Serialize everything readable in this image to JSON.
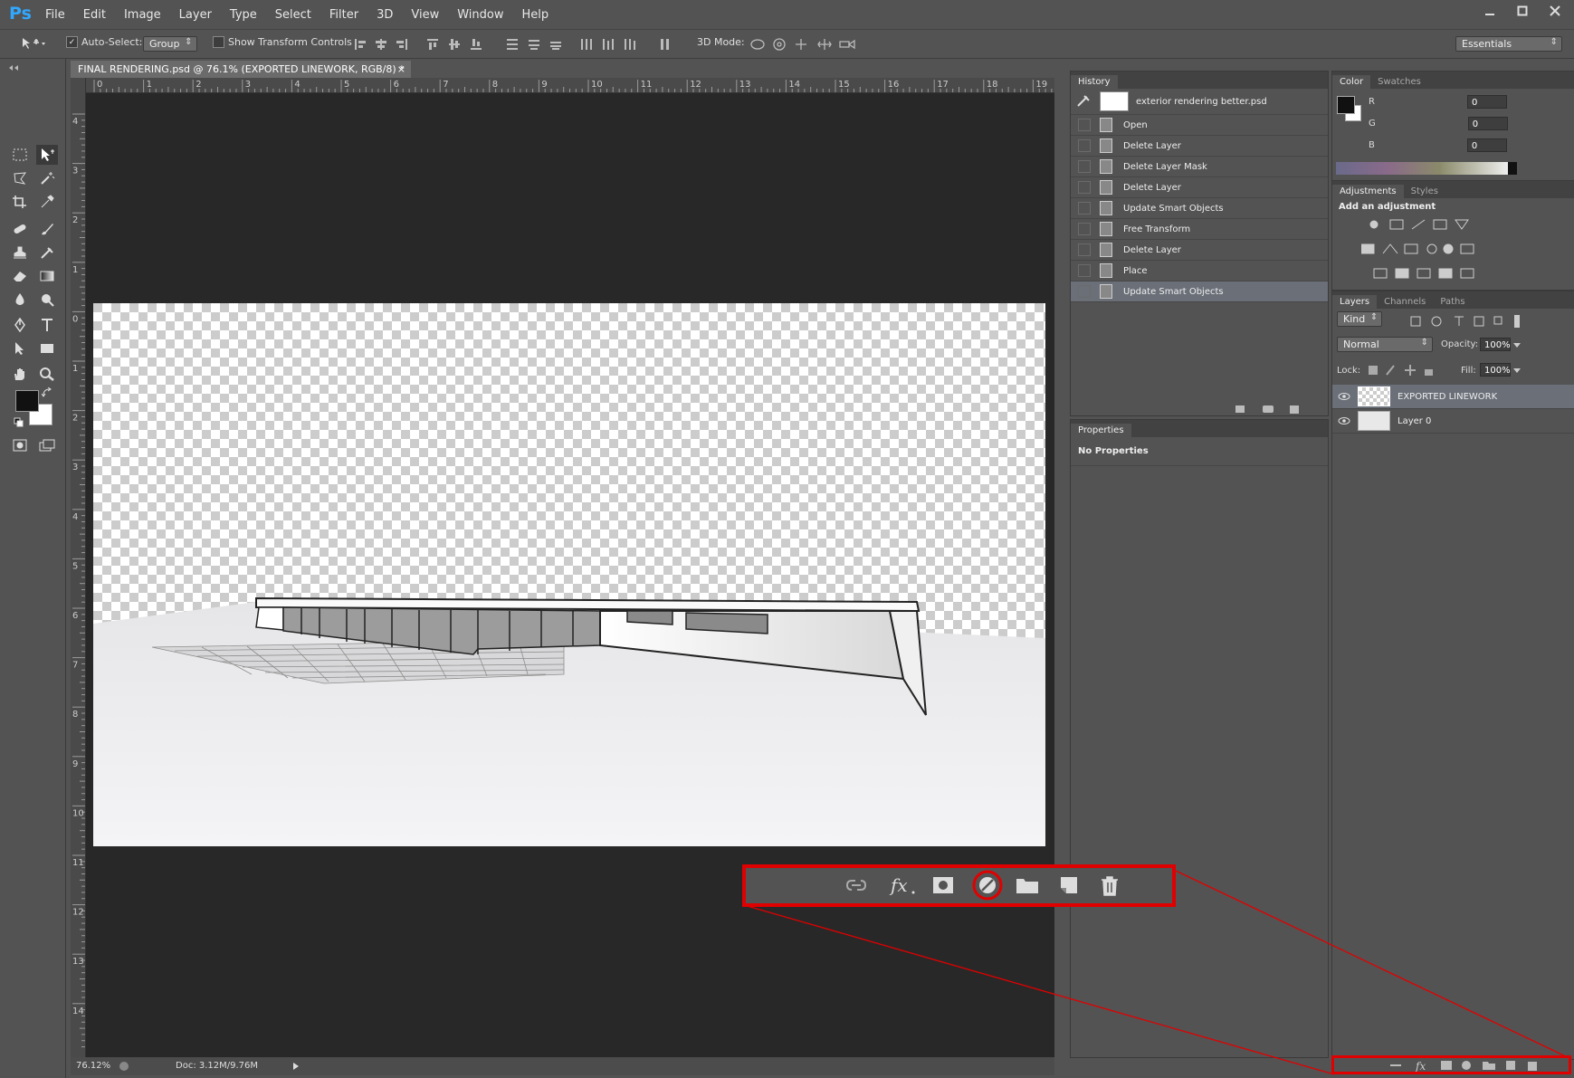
{
  "app": {
    "logo": "Ps"
  },
  "menu": [
    "File",
    "Edit",
    "Image",
    "Layer",
    "Type",
    "Select",
    "Filter",
    "3D",
    "View",
    "Window",
    "Help"
  ],
  "options_bar": {
    "auto_select_label": "Auto-Select:",
    "auto_select_value": "Group",
    "show_transform_label": "Show Transform Controls",
    "mode_3d_label": "3D Mode:",
    "workspace": "Essentials"
  },
  "document": {
    "tab_title": "FINAL RENDERING.psd @ 76.1% (EXPORTED LINEWORK, RGB/8) *",
    "zoom": "76.12%",
    "doc_size": "Doc: 3.12M/9.76M",
    "ruler_top": [
      "0",
      "1",
      "2",
      "3",
      "4",
      "5",
      "6",
      "7",
      "8",
      "9",
      "10",
      "11",
      "12",
      "13",
      "14",
      "15",
      "16",
      "17",
      "18",
      "19"
    ],
    "ruler_left": [
      "4",
      "3",
      "2",
      "1",
      "0",
      "1",
      "2",
      "3",
      "4",
      "5",
      "6",
      "7",
      "8",
      "9",
      "10",
      "11",
      "12",
      "13",
      "14"
    ]
  },
  "history": {
    "tab": "History",
    "snapshot": "exterior rendering better.psd",
    "items": [
      "Open",
      "Delete Layer",
      "Delete Layer Mask",
      "Delete Layer",
      "Update Smart Objects",
      "Free Transform",
      "Delete Layer",
      "Place",
      "Update Smart Objects"
    ]
  },
  "properties": {
    "tab": "Properties",
    "content": "No Properties"
  },
  "color": {
    "tabs": [
      "Color",
      "Swatches"
    ],
    "channels": [
      {
        "label": "R",
        "value": "0"
      },
      {
        "label": "G",
        "value": "0"
      },
      {
        "label": "B",
        "value": "0"
      }
    ]
  },
  "adjustments": {
    "tabs": [
      "Adjustments",
      "Styles"
    ],
    "heading": "Add an adjustment"
  },
  "layers": {
    "tabs": [
      "Layers",
      "Channels",
      "Paths"
    ],
    "filter_kind": "Kind",
    "blend_mode": "Normal",
    "opacity_label": "Opacity:",
    "opacity": "100%",
    "lock_label": "Lock:",
    "fill_label": "Fill:",
    "fill": "100%",
    "items": [
      {
        "name": "EXPORTED LINEWORK"
      },
      {
        "name": "Layer 0"
      }
    ]
  },
  "colors": {
    "highlight": "#e00000",
    "selection": "#6a6f78",
    "panel": "#535353"
  }
}
